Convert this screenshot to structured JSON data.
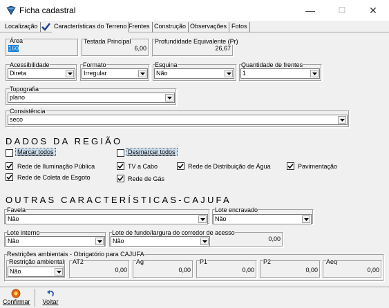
{
  "window": {
    "title": "Ficha cadastral",
    "minimize": "—",
    "maximize": "☐",
    "close": "✕"
  },
  "tabs": [
    {
      "label": "Localização"
    },
    {
      "label": "Características do Terreno",
      "active": true
    },
    {
      "label": "Frentes"
    },
    {
      "label": "Construção"
    },
    {
      "label": "Observações"
    },
    {
      "label": "Fotos"
    }
  ],
  "terreno": {
    "area_label": "Área",
    "area_value": "160",
    "testada_label": "Testada Principal",
    "testada_value": "6,00",
    "profundidade_label": "Profundidade Equivalente (Pr)",
    "profundidade_value": "26,67",
    "acessibilidade_label": "Acessibilidade",
    "acessibilidade_value": "Direta",
    "formato_label": "Formato",
    "formato_value": "Irregular",
    "esquina_label": "Esquina",
    "esquina_value": "Não",
    "qtd_frentes_label": "Quantidade de frentes",
    "qtd_frentes_value": "1",
    "topografia_label": "Topografia",
    "topografia_value": "plano",
    "consistencia_label": "Consistência",
    "consistencia_value": "seco"
  },
  "regiao": {
    "title": "DADOS DA REGIÃO",
    "marcar_todos": "Marcar todos",
    "desmarcar_todos": "Desmarcar todos",
    "items": [
      {
        "label": "Rede de Iluminação Pública",
        "checked": true
      },
      {
        "label": "TV a Cabo",
        "checked": true
      },
      {
        "label": "Rede de Distribuição de Água",
        "checked": true
      },
      {
        "label": "Pavimentação",
        "checked": true
      },
      {
        "label": "Rede de Coleta de Esgoto",
        "checked": true
      },
      {
        "label": "Rede de Gás",
        "checked": true
      }
    ]
  },
  "cajufa": {
    "title": "OUTRAS CARACTERÍSTICAS-CAJUFA",
    "favela_label": "Favela",
    "favela_value": "Não",
    "lote_encravado_label": "Lote encravado",
    "lote_encravado_value": "Não",
    "lote_interno_label": "Lote interno",
    "lote_interno_value": "Não",
    "lote_fundo_label": "Lote de fundo/largura do corredor de acesso",
    "lote_fundo_value": "Não",
    "lote_fundo_num": "0,00",
    "restricoes_label": "Restrições ambientais - Obrigatório para CAJUFA",
    "restricao_label": "Restrição ambiental",
    "restricao_value": "Não",
    "at2_label": "AT2",
    "at2_value": "0,00",
    "ag_label": "Ag",
    "ag_value": "0,00",
    "p1_label": "P1",
    "p1_value": "0,00",
    "p2_label": "P2",
    "p2_value": "0,00",
    "aeq_label": "Aeq",
    "aeq_value": "0,00"
  },
  "footer": {
    "confirmar": "Confirmar",
    "voltar": "Voltar"
  },
  "colors": {
    "accent": "#0078d7",
    "highlight": "#cfe0f0"
  }
}
